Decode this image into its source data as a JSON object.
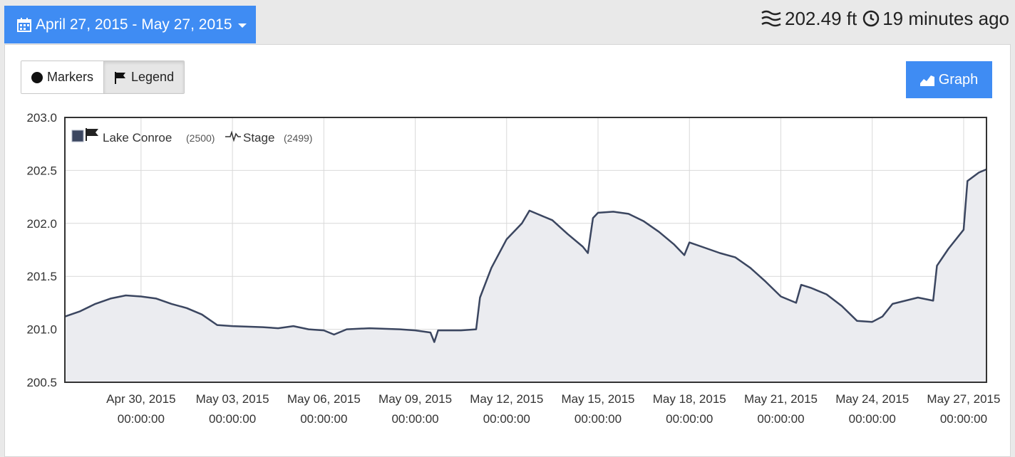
{
  "header": {
    "date_range_label": "April 27, 2015 - May 27, 2015",
    "current_level": "202.49 ft",
    "last_updated": "19 minutes ago"
  },
  "toolbar": {
    "markers_label": "Markers",
    "legend_label": "Legend",
    "graph_label": "Graph"
  },
  "colors": {
    "accent": "#3f8cf3",
    "series_line": "#3b4660",
    "series_fill": "#ebecf0",
    "grid": "#d9d9d9"
  },
  "chart_data": {
    "type": "area",
    "title": "",
    "xlabel": "",
    "ylabel": "",
    "ylim": [
      200.5,
      203.0
    ],
    "xlim": [
      "2015-04-27 12:00",
      "2015-05-27 18:00"
    ],
    "grid": true,
    "legend_position": "top-left",
    "y_ticks": [
      "203.0",
      "202.5",
      "202.0",
      "201.5",
      "201.0",
      "200.5"
    ],
    "x_ticks": [
      {
        "date": "2015-04-30 00:00",
        "label": "Apr 30, 2015",
        "sub": "00:00:00"
      },
      {
        "date": "2015-05-03 00:00",
        "label": "May 03, 2015",
        "sub": "00:00:00"
      },
      {
        "date": "2015-05-06 00:00",
        "label": "May 06, 2015",
        "sub": "00:00:00"
      },
      {
        "date": "2015-05-09 00:00",
        "label": "May 09, 2015",
        "sub": "00:00:00"
      },
      {
        "date": "2015-05-12 00:00",
        "label": "May 12, 2015",
        "sub": "00:00:00"
      },
      {
        "date": "2015-05-15 00:00",
        "label": "May 15, 2015",
        "sub": "00:00:00"
      },
      {
        "date": "2015-05-18 00:00",
        "label": "May 18, 2015",
        "sub": "00:00:00"
      },
      {
        "date": "2015-05-21 00:00",
        "label": "May 21, 2015",
        "sub": "00:00:00"
      },
      {
        "date": "2015-05-24 00:00",
        "label": "May 24, 2015",
        "sub": "00:00:00"
      },
      {
        "date": "2015-05-27 00:00",
        "label": "May 27, 2015",
        "sub": "00:00:00"
      }
    ],
    "legend": [
      {
        "name": "Lake Conroe",
        "id": "(2500)"
      },
      {
        "name": "Stage",
        "id": "(2499)"
      }
    ],
    "series": [
      {
        "name": "Stage",
        "points": [
          [
            "2015-04-27 12:00",
            201.12
          ],
          [
            "2015-04-28 00:00",
            201.17
          ],
          [
            "2015-04-28 12:00",
            201.24
          ],
          [
            "2015-04-29 00:00",
            201.29
          ],
          [
            "2015-04-29 12:00",
            201.32
          ],
          [
            "2015-04-30 00:00",
            201.31
          ],
          [
            "2015-04-30 12:00",
            201.29
          ],
          [
            "2015-05-01 00:00",
            201.24
          ],
          [
            "2015-05-01 12:00",
            201.2
          ],
          [
            "2015-05-02 00:00",
            201.14
          ],
          [
            "2015-05-02 12:00",
            201.04
          ],
          [
            "2015-05-03 00:00",
            201.03
          ],
          [
            "2015-05-04 00:00",
            201.02
          ],
          [
            "2015-05-04 12:00",
            201.01
          ],
          [
            "2015-05-05 00:00",
            201.03
          ],
          [
            "2015-05-05 12:00",
            201.0
          ],
          [
            "2015-05-06 00:00",
            200.99
          ],
          [
            "2015-05-06 08:00",
            200.95
          ],
          [
            "2015-05-06 18:00",
            201.0
          ],
          [
            "2015-05-07 12:00",
            201.01
          ],
          [
            "2015-05-08 12:00",
            201.0
          ],
          [
            "2015-05-09 00:00",
            200.99
          ],
          [
            "2015-05-09 12:00",
            200.97
          ],
          [
            "2015-05-09 15:00",
            200.88
          ],
          [
            "2015-05-09 18:00",
            200.99
          ],
          [
            "2015-05-10 12:00",
            200.99
          ],
          [
            "2015-05-11 00:00",
            201.0
          ],
          [
            "2015-05-11 03:00",
            201.3
          ],
          [
            "2015-05-11 12:00",
            201.58
          ],
          [
            "2015-05-12 00:00",
            201.85
          ],
          [
            "2015-05-12 12:00",
            202.0
          ],
          [
            "2015-05-12 18:00",
            202.12
          ],
          [
            "2015-05-13 00:00",
            202.09
          ],
          [
            "2015-05-13 12:00",
            202.03
          ],
          [
            "2015-05-14 00:00",
            201.9
          ],
          [
            "2015-05-14 12:00",
            201.78
          ],
          [
            "2015-05-14 16:00",
            201.72
          ],
          [
            "2015-05-14 20:00",
            202.05
          ],
          [
            "2015-05-15 00:00",
            202.1
          ],
          [
            "2015-05-15 12:00",
            202.11
          ],
          [
            "2015-05-16 00:00",
            202.09
          ],
          [
            "2015-05-16 12:00",
            202.02
          ],
          [
            "2015-05-17 00:00",
            201.92
          ],
          [
            "2015-05-17 12:00",
            201.8
          ],
          [
            "2015-05-17 20:00",
            201.7
          ],
          [
            "2015-05-18 00:00",
            201.82
          ],
          [
            "2015-05-18 12:00",
            201.77
          ],
          [
            "2015-05-19 00:00",
            201.72
          ],
          [
            "2015-05-19 12:00",
            201.68
          ],
          [
            "2015-05-20 00:00",
            201.58
          ],
          [
            "2015-05-20 12:00",
            201.45
          ],
          [
            "2015-05-21 00:00",
            201.31
          ],
          [
            "2015-05-21 12:00",
            201.25
          ],
          [
            "2015-05-21 16:00",
            201.42
          ],
          [
            "2015-05-22 00:00",
            201.39
          ],
          [
            "2015-05-22 12:00",
            201.33
          ],
          [
            "2015-05-23 00:00",
            201.22
          ],
          [
            "2015-05-23 12:00",
            201.08
          ],
          [
            "2015-05-24 00:00",
            201.07
          ],
          [
            "2015-05-24 08:00",
            201.12
          ],
          [
            "2015-05-24 16:00",
            201.24
          ],
          [
            "2015-05-25 12:00",
            201.3
          ],
          [
            "2015-05-26 00:00",
            201.27
          ],
          [
            "2015-05-26 03:00",
            201.6
          ],
          [
            "2015-05-26 12:00",
            201.76
          ],
          [
            "2015-05-27 00:00",
            201.94
          ],
          [
            "2015-05-27 03:00",
            202.4
          ],
          [
            "2015-05-27 12:00",
            202.48
          ],
          [
            "2015-05-27 18:00",
            202.51
          ]
        ]
      }
    ]
  }
}
